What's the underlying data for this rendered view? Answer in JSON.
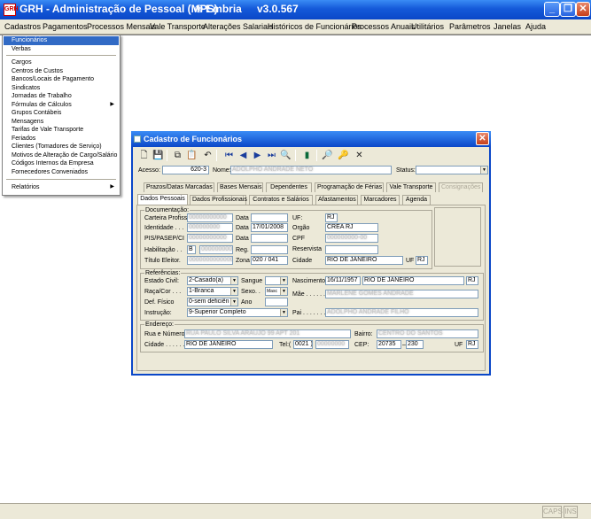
{
  "window": {
    "title": "GRH - Administração de Pessoal (MPS)",
    "brand": "® Embria",
    "version": "v3.0.567",
    "icon_text": "GRH"
  },
  "menu": [
    "Cadastros",
    "Pagamentos",
    "Processos Mensais",
    "Vale Transporte",
    "Alterações Salariais",
    "Históricos de Funcionários",
    "Processos Anuais",
    "Utilitários",
    "Parâmetros",
    "Janelas",
    "Ajuda"
  ],
  "dropdown": {
    "items": [
      "Funcionários",
      "Verbas",
      "Cargos",
      "Centros de Custos",
      "Bancos/Locais de Pagamento",
      "Sindicatos",
      "Jornadas de Trabalho",
      "Fórmulas de Cálculos",
      "Grupos Contábeis",
      "Mensagens",
      "Tarifas de Vale Transporte",
      "Feriados",
      "Clientes (Tomadores de Serviço)",
      "Motivos de Alteração de Cargo/Salário",
      "Códigos Internos da Empresa",
      "Fornecedores Conveniados",
      "Relatórios"
    ],
    "arrow": "▶"
  },
  "dialog": {
    "title": "Cadastro de Funcionários",
    "close": "✕",
    "acesso_label": "Acesso:",
    "acesso_value": "620-3",
    "nome_label": "Nome:",
    "nome_value": "ADOLPHO ANDRADE NETO",
    "status_label": "Status:",
    "status_value": "",
    "tabs_row1": [
      "Prazos/Datas Marcadas",
      "Bases Mensais",
      "Dependentes",
      "Programação de Férias",
      "Vale Transporte",
      "Consignações"
    ],
    "tabs_row2": [
      "Dados Pessoais",
      "Dados Profissionais",
      "Contratos e Salários",
      "Afastamentos",
      "Marcadores",
      "Agenda"
    ],
    "doc": {
      "title": "Documentação:",
      "carteira_label": "Carteira Profiss.",
      "carteira_value": "00000000000",
      "data_label": "Data",
      "uf_label": "UF:",
      "uf_value": "RJ",
      "identidade_label": "Identidade . . .",
      "identidade_value": "000000000",
      "identidade_data": "17/01/2008",
      "orgao_label": "Orgão",
      "orgao_value": "CREA RJ",
      "pis_label": "PIS/PASEP/CI",
      "pis_value": "00000000000",
      "cpf_label": "CPF",
      "cpf_value": "000000000-00",
      "habilitacao_label": "Habilitação . .",
      "habilitacao_cat": "B",
      "habilitacao_value": "000000000",
      "reg_label": "Reg.",
      "reservista_label": "Reservista",
      "titulo_label": "Título Eleitor.",
      "titulo_value": "0000000000000",
      "zona_label": "Zona",
      "zona_value": "020 / 041",
      "cidade_label": "Cidade",
      "cidade_value": "RIO DE JANEIRO",
      "uf2_label": "UF",
      "uf2_value": "RJ"
    },
    "ref": {
      "title": "Referências:",
      "estado_label": "Estado Civil:",
      "estado_value": "2-Casado(a)",
      "sangue_label": "Sangue",
      "nascimento_label": "Nascimento",
      "nascimento_value": "16/11/1957",
      "nasc_cidade": "RIO DE JANEIRO",
      "nasc_uf": "RJ",
      "raca_label": "Raça/Cor . . .",
      "raca_value": "1-Branca",
      "sexo_label": "Sexo. .",
      "sexo_value": "Masc",
      "mae_label": "Mãe . . . . . .",
      "mae_value": "MARLENE GOMES ANDRADE",
      "deffisico_label": "Def. Físico",
      "deffisico_value": "0-sem deficiên",
      "ano_label": "Ano",
      "instrucao_label": "Instrução:",
      "instrucao_value": "9-Superior Completo",
      "pai_label": "Pai . . . . . . .",
      "pai_value": "ADOLPHO ANDRADE FILHO"
    },
    "end": {
      "title": "Endereço:",
      "rua_label": "Rua e Número:",
      "rua_value": "RUA PAULO SILVA ARAUJO 99 APT 201",
      "bairro_label": "Bairro:",
      "bairro_value": "CENTRO DO SANTOS",
      "cidade_label": "Cidade . . . . . .",
      "cidade_value": "RIO DE JANEIRO",
      "tel_label": "Tel:(",
      "tel_ddd": "0021 )",
      "tel_value": "00000000",
      "cep_label": "CEP:",
      "cep_value": "20735",
      "cep_suffix": "230",
      "uf_label": "UF",
      "uf_value": "RJ"
    }
  },
  "statusbar": {
    "caps": "CAPS",
    "ins": "INS"
  }
}
